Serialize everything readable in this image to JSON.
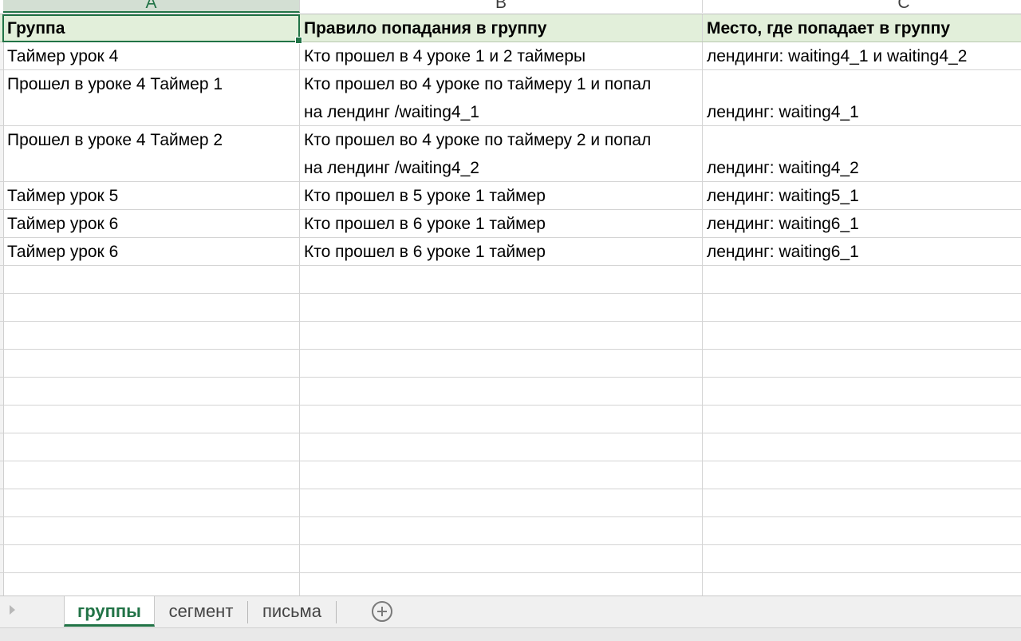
{
  "columns": [
    "A",
    "B",
    "C"
  ],
  "header": {
    "group": "Группа",
    "rule": "Правило попадания в группу",
    "place": "Место, где попадает в группу"
  },
  "rows": [
    {
      "group": "Таймер урок 4",
      "rule": "Кто прошел в 4 уроке  1 и 2 таймеры",
      "place": "лендинги: waiting4_1 и waiting4_2"
    },
    {
      "group": "Прошел  в уроке 4 Таймер 1",
      "rule": "Кто прошел во 4 уроке по таймеру 1 и попал на лендинг /waiting4_1",
      "place": "лендинг: waiting4_1"
    },
    {
      "group": "Прошел  в уроке 4 Таймер 2",
      "rule": "Кто прошел во 4 уроке по таймеру 2 и попал на лендинг /waiting4_2",
      "place": "лендинг: waiting4_2"
    },
    {
      "group": "Таймер урок 5",
      "rule": "Кто прошел в 5 уроке  1 таймер",
      "place": "лендинг: waiting5_1"
    },
    {
      "group": "Таймер урок 6",
      "rule": "Кто прошел в 6 уроке  1 таймер",
      "place": "лендинг: waiting6_1"
    },
    {
      "group": "Таймер урок 6",
      "rule": "Кто прошел в 6 уроке  1 таймер",
      "place": "лендинг: waiting6_1"
    }
  ],
  "sheets": [
    "группы",
    "сегмент",
    "письма"
  ],
  "active_sheet": "группы",
  "icons": {
    "add_sheet": "plus-circle-icon",
    "scroll_left": "triangle-right-icon"
  },
  "colors": {
    "accent": "#217346",
    "header_fill": "#e2efda"
  }
}
